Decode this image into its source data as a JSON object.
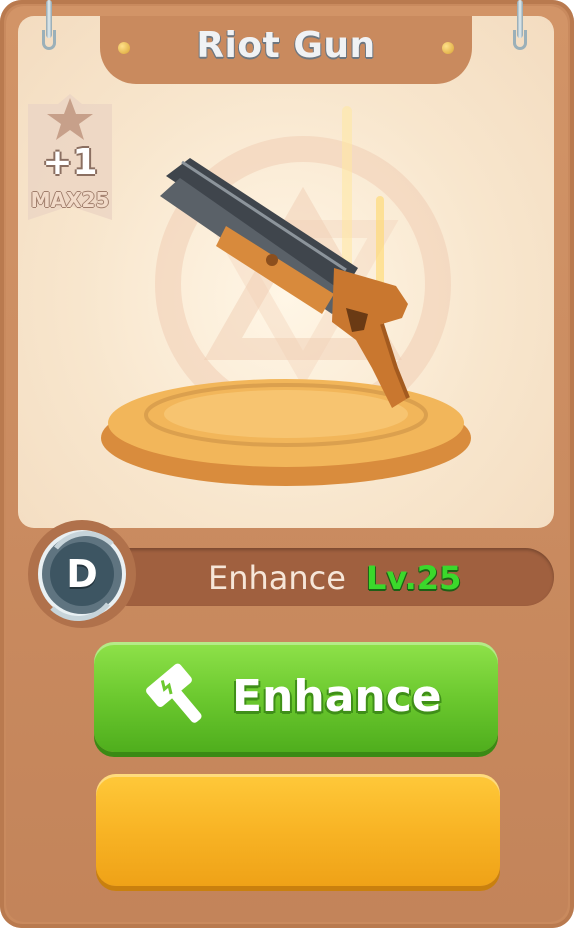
{
  "item": {
    "name": "Riot Gun",
    "enhance_count": "+1",
    "enhance_max": "MAX25",
    "grade": "D"
  },
  "info_bar": {
    "label": "Enhance",
    "level": "Lv.25"
  },
  "buttons": {
    "enhance_label": "Enhance",
    "enhance_icon": "hammer-icon",
    "secondary_label": ""
  },
  "colors": {
    "card": "#c98a5e",
    "level_text": "#3bd82b",
    "enhance_button": "#6cc92f",
    "secondary_button": "#f8b425"
  }
}
